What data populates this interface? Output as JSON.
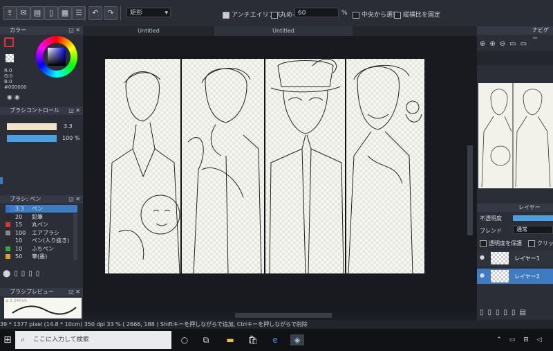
{
  "toolbar": {
    "shape": "矩形",
    "antialias_label": "アンチエイリアス",
    "round_label": "丸める",
    "round_value": "60",
    "percent": "%",
    "center_label": "中央から選択",
    "aspect_label": "縦横比を固定"
  },
  "tabs": [
    "Untitled",
    "Untitled"
  ],
  "color_panel": {
    "title": "カラー",
    "r": "R:0",
    "g": "G:0",
    "b": "B:0",
    "hex": "#000000"
  },
  "brush_control": {
    "title": "ブラシコントロール",
    "size": "3.3",
    "opacity": "100 %"
  },
  "brush_panel": {
    "title": "ブラシ: ペン",
    "items": [
      {
        "size": "3.3",
        "name": "ペン",
        "color": "#2d6fd1"
      },
      {
        "size": "20",
        "name": "鉛筆",
        "color": "#2a2a2a"
      },
      {
        "size": "15",
        "name": "丸ペン",
        "color": "#d33"
      },
      {
        "size": "100",
        "name": "エアブラシ",
        "color": "#888"
      },
      {
        "size": "10",
        "name": "ペン(入り抜き)",
        "color": "#2a2a2a"
      },
      {
        "size": "10",
        "name": "ふちペン",
        "color": "#3a3"
      },
      {
        "size": "50",
        "name": "筆(墨)",
        "color": "#e0a020"
      }
    ]
  },
  "brush_preview": {
    "title": "ブラシプレビュー",
    "size_text": "φ 0.24mm"
  },
  "navigator": {
    "title": "ナビゲー"
  },
  "layer_panel": {
    "title": "レイヤー",
    "opacity_label": "不透明度",
    "blend_label": "ブレンド",
    "blend_value": "通常",
    "protect_label": "透明度を保護",
    "clipping_label": "クリッピン",
    "layers": [
      {
        "name": "レイヤー1",
        "selected": false
      },
      {
        "name": "レイヤー2",
        "selected": true
      }
    ]
  },
  "status": {
    "text": "39 * 1377 pixel   (14.8 * 10cm)   350 dpi   33 %   ( 2666, 188 )   Shiftキーを押しながらで追加, Ctrlキーを押しながらで削除"
  },
  "taskbar": {
    "search_placeholder": "ここに入力して検索"
  },
  "colors": {
    "accent": "#3d7cc3",
    "panel": "#2b2e36",
    "canvas_bg": "#181a20"
  }
}
